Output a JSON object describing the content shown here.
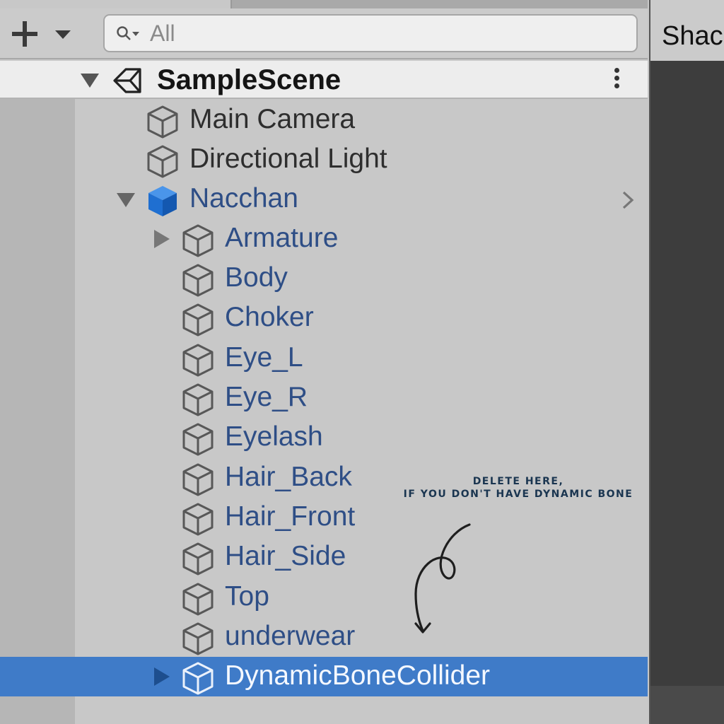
{
  "toolbar": {
    "add_label": "+",
    "search_placeholder": "All"
  },
  "right_pane": {
    "header": "Shac"
  },
  "scene": {
    "name": "SampleScene"
  },
  "tree": {
    "main_camera": "Main Camera",
    "directional_light": "Directional Light",
    "root_prefab": "Nacchan",
    "children": [
      "Armature",
      "Body",
      "Choker",
      "Eye_L",
      "Eye_R",
      "Eyelash",
      "Hair_Back",
      "Hair_Front",
      "Hair_Side",
      "Top",
      "underwear",
      "DynamicBoneCollider"
    ]
  },
  "annotation": {
    "line1": "Delete here,",
    "line2": "if you don't have dynamic bone"
  },
  "colors": {
    "selection": "#3f7bc8",
    "prefab_text": "#2e4e86",
    "prefab_icon": "#1f6fd1",
    "annotation_text": "#1a3550"
  },
  "icons": {
    "add": "plus-icon",
    "search": "search-icon",
    "scene": "unity-logo-icon",
    "gameobject": "cube-outline-icon",
    "prefab": "cube-blue-icon"
  }
}
